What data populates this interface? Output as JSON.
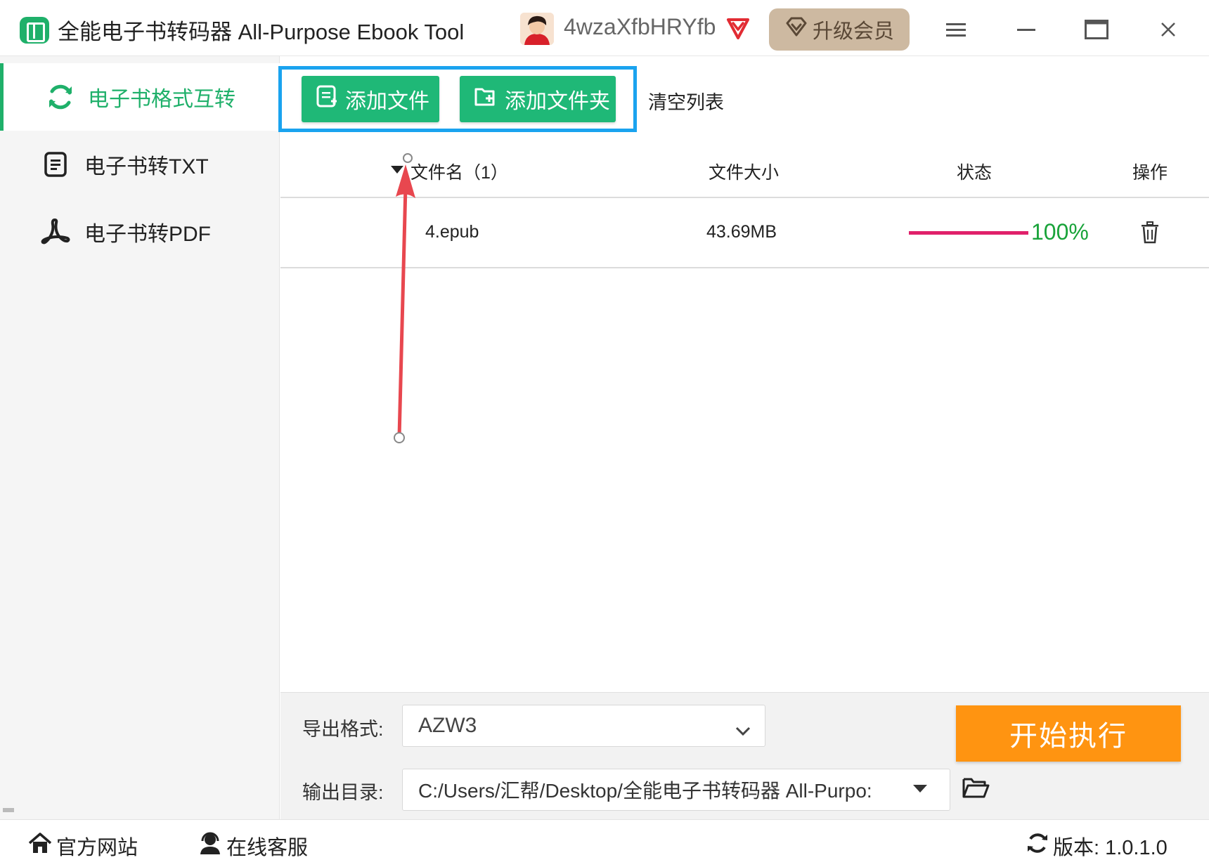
{
  "window": {
    "title": "全能电子书转码器 All-Purpose Ebook Tool",
    "username": "4wzaXfbHRYfb",
    "upgrade_label": "升级会员",
    "icons": [
      "app-logo-icon",
      "vip-badge-icon",
      "menu-icon",
      "minimize-icon",
      "maximize-icon",
      "close-icon"
    ]
  },
  "sidebar": {
    "items": [
      {
        "label": "电子书格式互转",
        "icon": "convert-refresh-icon",
        "active": true
      },
      {
        "label": "电子书转TXT",
        "icon": "txt-document-icon",
        "active": false
      },
      {
        "label": "电子书转PDF",
        "icon": "pdf-icon",
        "active": false
      }
    ]
  },
  "toolbar": {
    "add_file_label": "添加文件",
    "add_folder_label": "添加文件夹",
    "clear_label": "清空列表"
  },
  "table": {
    "headers": {
      "filename": "文件名（1）",
      "size": "文件大小",
      "status": "状态",
      "action": "操作"
    },
    "rows": [
      {
        "filename": "4.epub",
        "size": "43.69MB",
        "status": "100%",
        "progress": 1.0
      }
    ]
  },
  "settings": {
    "format_label": "导出格式:",
    "format_value": "AZW3",
    "output_label": "输出目录:",
    "output_value": "C:/Users/汇帮/Desktop/全能电子书转码器 All-Purpo:",
    "start_label": "开始执行"
  },
  "footer": {
    "website_label": "官方网站",
    "support_label": "在线客服",
    "version_label": "版本:  1.0.1.0"
  },
  "colors": {
    "accent_green": "#1fb06a",
    "button_green": "#1fb877",
    "highlight_blue": "#1aa3ef",
    "start_orange": "#ff9411",
    "progress_pink": "#e0206a",
    "progress_text_green": "#19a33a",
    "annotation_red": "#e8474f"
  }
}
